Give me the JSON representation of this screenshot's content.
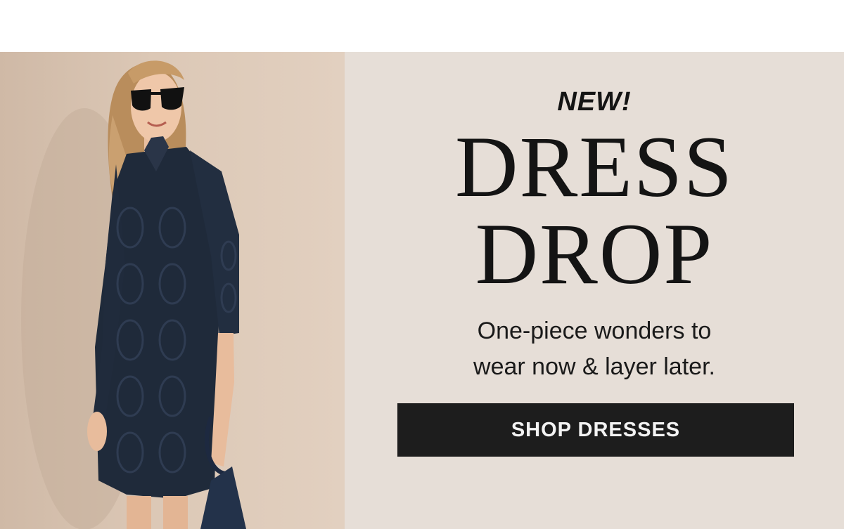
{
  "banner": {
    "eyebrow": "NEW!",
    "headline_line1": "DRESS",
    "headline_line2": "DROP",
    "subcopy_line1": "One-piece wonders to",
    "subcopy_line2": "wear now & layer later.",
    "cta_label": "SHOP DRESSES"
  },
  "colors": {
    "page_background": "#ffffff",
    "banner_background": "#e6ded7",
    "photo_background": "#d8c4b2",
    "text": "#141414",
    "cta_background": "#1d1d1d",
    "cta_text": "#f3f3f3",
    "dress": "#1f2a3a"
  },
  "photo": {
    "subject": "model-in-navy-eyelet-dress"
  }
}
